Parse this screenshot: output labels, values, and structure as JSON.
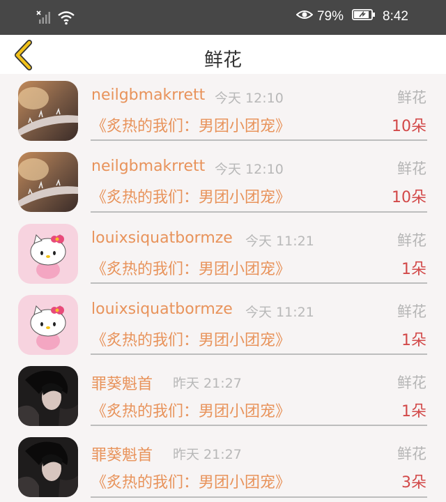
{
  "status_bar": {
    "battery_percent": "79%",
    "time": "8:42",
    "icons": [
      "no-sim-signal-icon",
      "wifi-icon",
      "eye-icon",
      "battery-icon"
    ]
  },
  "header": {
    "title": "鲜花",
    "back_icon": "chevron-left-icon",
    "accent_color": "#f2c21b"
  },
  "colors": {
    "name": "#e8935b",
    "count": "#d24848",
    "muted": "#b8b8b8"
  },
  "items": [
    {
      "user": "neilgbmakrrett",
      "time": "今天 12:10",
      "gift": "鲜花",
      "book": "《炙热的我们：男团小团宠》",
      "count": "10朵",
      "avatar": "thorn-photo"
    },
    {
      "user": "neilgbmakrrett",
      "time": "今天 12:10",
      "gift": "鲜花",
      "book": "《炙热的我们：男团小团宠》",
      "count": "10朵",
      "avatar": "thorn-photo"
    },
    {
      "user": "louixsiquatbormze",
      "time": "今天 11:21",
      "gift": "鲜花",
      "book": "《炙热的我们：男团小团宠》",
      "count": "1朵",
      "avatar": "hello-kitty"
    },
    {
      "user": "louixsiquatbormze",
      "time": "今天 11:21",
      "gift": "鲜花",
      "book": "《炙热的我们：男团小团宠》",
      "count": "1朵",
      "avatar": "hello-kitty"
    },
    {
      "user": "罪葵魁首",
      "time": "昨天 21:27",
      "gift": "鲜花",
      "book": "《炙热的我们：男团小团宠》",
      "count": "1朵",
      "avatar": "dark-portrait"
    },
    {
      "user": "罪葵魁首",
      "time": "昨天 21:27",
      "gift": "鲜花",
      "book": "《炙热的我们：男团小团宠》",
      "count": "3朵",
      "avatar": "dark-portrait"
    }
  ]
}
